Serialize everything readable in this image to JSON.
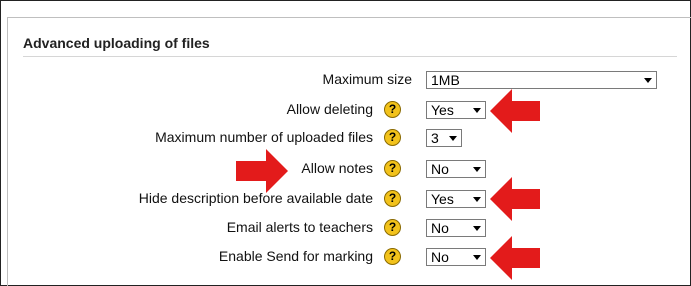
{
  "section": {
    "title": "Advanced uploading of files"
  },
  "help_glyph": "?",
  "fields": {
    "max_size": {
      "label": "Maximum size",
      "value": "1MB"
    },
    "allow_deleting": {
      "label": "Allow deleting",
      "value": "Yes"
    },
    "max_files": {
      "label": "Maximum number of uploaded files",
      "value": "3"
    },
    "allow_notes": {
      "label": "Allow notes",
      "value": "No"
    },
    "hide_description": {
      "label": "Hide description before available date",
      "value": "Yes"
    },
    "email_alerts": {
      "label": "Email alerts to teachers",
      "value": "No"
    },
    "enable_send": {
      "label": "Enable Send for marking",
      "value": "No"
    }
  },
  "icons": {
    "help": "help-icon",
    "caret": "chevron-down-icon",
    "annotation_arrow": "red-arrow-icon"
  },
  "colors": {
    "help_icon": "#f2c21b",
    "annotation_arrow": "#e31b1b"
  }
}
